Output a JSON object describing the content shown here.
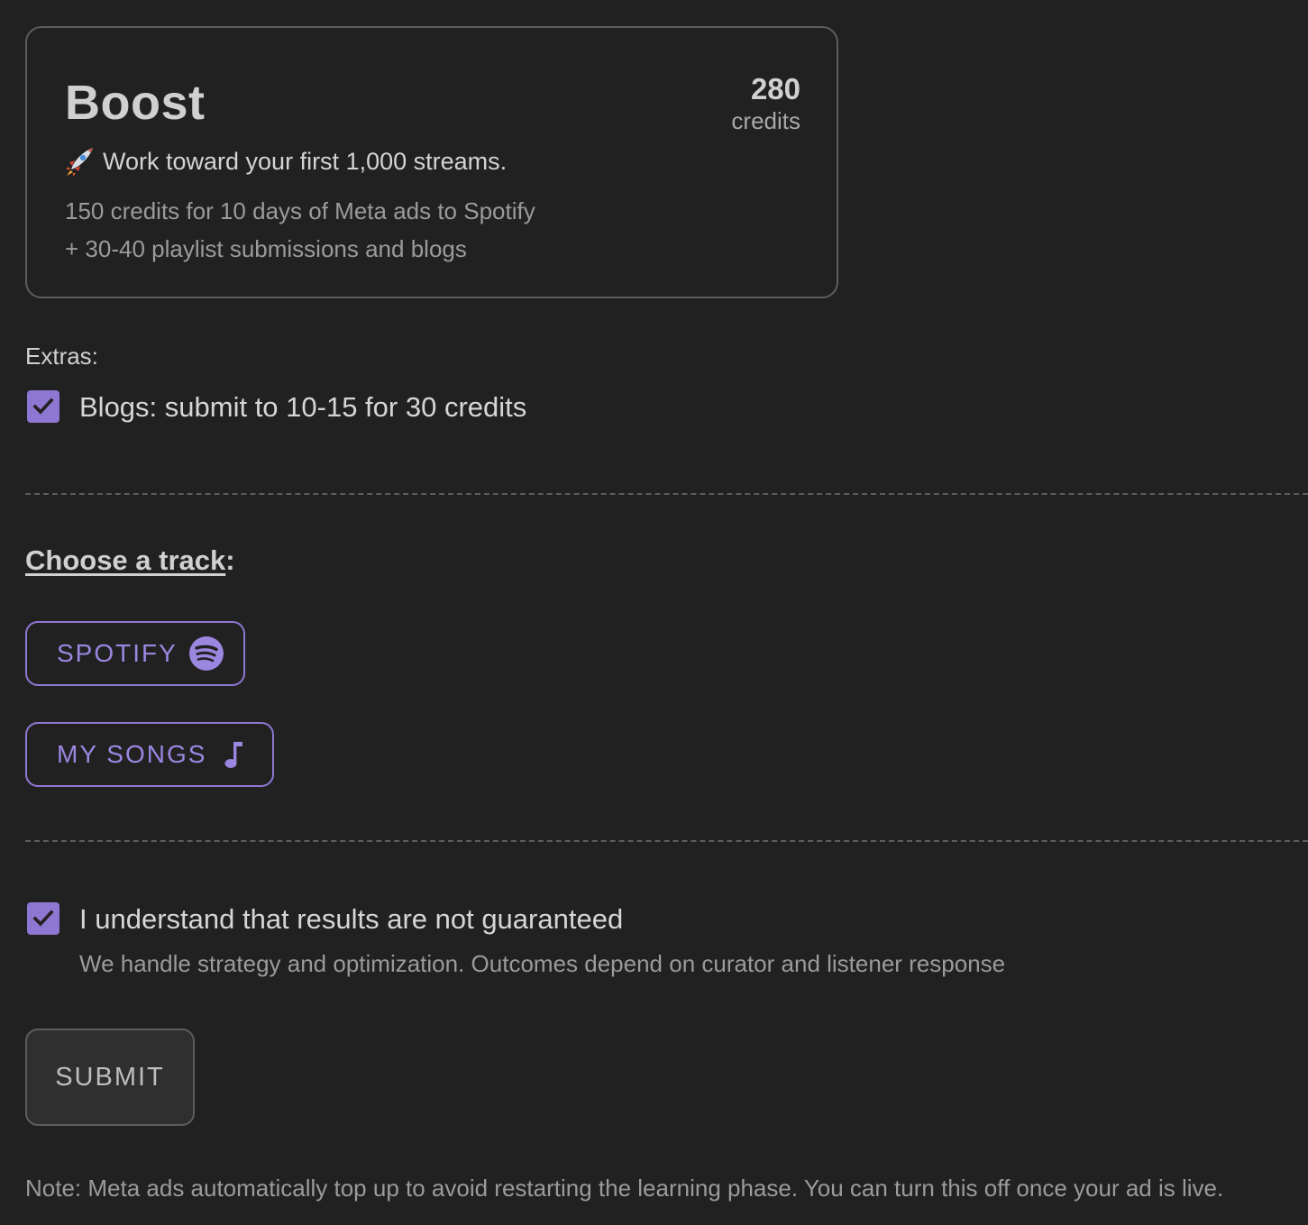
{
  "plan": {
    "title": "Boost",
    "credits_value": "280",
    "credits_unit": "credits",
    "tagline": "Work toward your first 1,000 streams.",
    "detail_line1": "150 credits for 10 days of Meta ads to Spotify",
    "detail_line2": "+ 30-40 playlist submissions and blogs",
    "tagline_icon": "rocket-icon"
  },
  "extras": {
    "label": "Extras:",
    "blogs": {
      "label": "Blogs: submit to 10-15 for 30 credits",
      "checked": true
    }
  },
  "track": {
    "label": "Choose a track",
    "label_suffix": ":",
    "options": [
      {
        "label": "SPOTIFY",
        "icon": "spotify-icon"
      },
      {
        "label": "MY SONGS",
        "icon": "music-note-icon"
      }
    ]
  },
  "consent": {
    "label": "I understand that results are not guaranteed",
    "sublabel": "We handle strategy and optimization. Outcomes depend on curator and listener response",
    "checked": true
  },
  "submit_label": "SUBMIT",
  "note": "Note: Meta ads automatically top up to avoid restarting the learning phase. You can turn this off once your ad is live.",
  "colors": {
    "background": "#212121",
    "accent": "#8e77d3",
    "border": "#5d5d5d"
  }
}
